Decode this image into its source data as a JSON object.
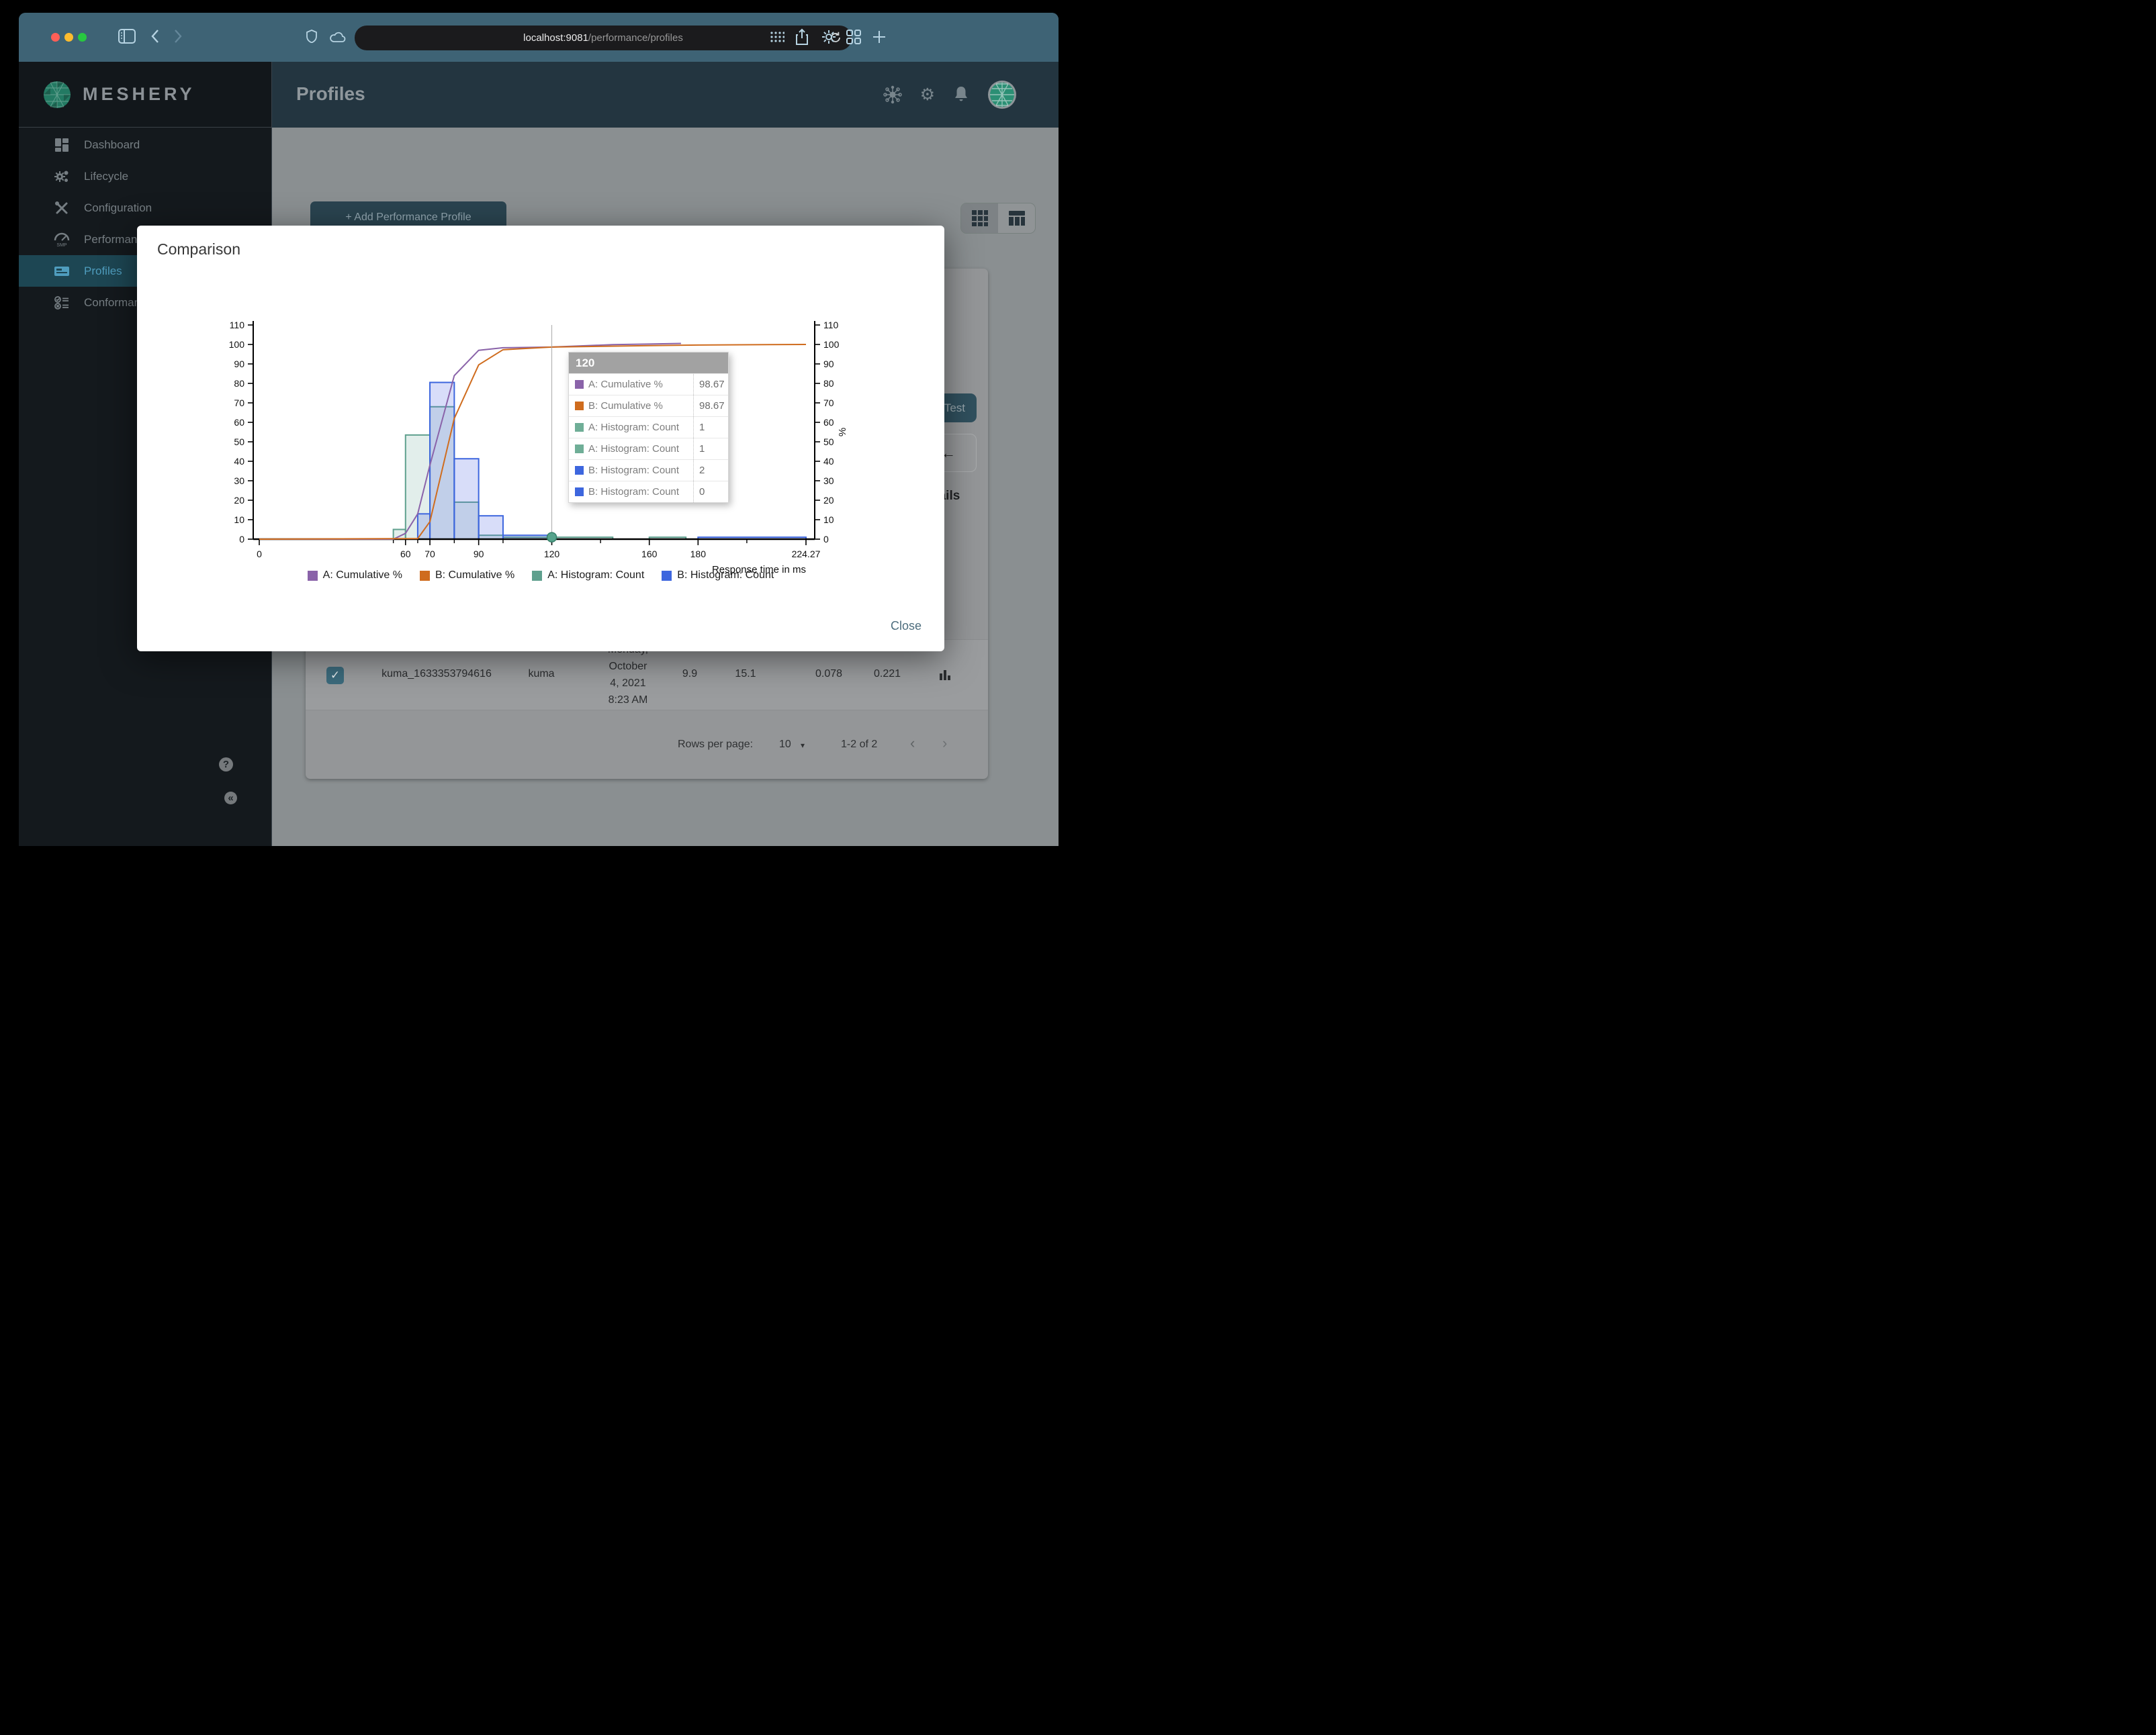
{
  "browser": {
    "url_host": "localhost:9081",
    "url_path": "/performance/profiles"
  },
  "sidebar": {
    "logo_text": "MESHERY",
    "items": [
      {
        "label": "Dashboard",
        "icon": "dashboard-icon",
        "selected": false
      },
      {
        "label": "Lifecycle",
        "icon": "lifecycle-icon",
        "selected": false
      },
      {
        "label": "Configuration",
        "icon": "configuration-icon",
        "selected": false
      },
      {
        "label": "Performance",
        "icon": "performance-icon",
        "selected": false
      },
      {
        "label": "Profiles",
        "icon": "profiles-icon",
        "selected": true
      },
      {
        "label": "Conformance",
        "icon": "conformance-icon",
        "selected": false
      }
    ],
    "help_label": "?",
    "collapse_label": "«"
  },
  "header": {
    "title": "Profiles"
  },
  "content": {
    "add_button_label": "+ Add Performance Profile",
    "test_button_label": "Test",
    "details_heading": "Details",
    "back_arrow": "←",
    "table_row": {
      "name": "kuma_1633353794616",
      "mesh": "kuma",
      "date_lines": [
        "Monday,",
        "October",
        "4, 2021",
        "8:23 AM"
      ],
      "qps": "9.9",
      "duration": "15.1",
      "p50": "0.078",
      "p99": "0.221"
    },
    "pagination": {
      "rows_per_page_label": "Rows per page:",
      "rows_per_page_value": "10",
      "range_label": "1-2 of 2"
    }
  },
  "modal": {
    "title": "Comparison",
    "close_label": "Close",
    "chart_data": {
      "type": "combo-histogram-cumulative",
      "x_axis": {
        "label": "Response time in ms",
        "range": [
          0,
          224.27
        ],
        "ticks_labeled": [
          0,
          60,
          70,
          90,
          120,
          160,
          180,
          224.27
        ],
        "tick_label_strings": [
          "0",
          "60",
          "70",
          "90",
          "120",
          "160",
          "180",
          "224.27"
        ],
        "ticks_minor": [
          55,
          65,
          80,
          100,
          140,
          200
        ]
      },
      "y_axis": {
        "range": [
          0,
          110
        ],
        "tick_step": 10,
        "right_label": "%"
      },
      "series": [
        {
          "name": "A: Cumulative %",
          "type": "line",
          "color": "#8a63a9",
          "points": [
            [
              0,
              0
            ],
            [
              55,
              0
            ],
            [
              60,
              3
            ],
            [
              65,
              13
            ],
            [
              70,
              38
            ],
            [
              80,
              84
            ],
            [
              90,
              97
            ],
            [
              100,
              98.3
            ],
            [
              120,
              98.67
            ],
            [
              145,
              99.9
            ],
            [
              160,
              100.2
            ],
            [
              173,
              100.5
            ]
          ]
        },
        {
          "name": "B: Cumulative %",
          "type": "line",
          "color": "#cf6c1e",
          "points": [
            [
              0,
              0
            ],
            [
              65,
              0.3
            ],
            [
              70,
              9
            ],
            [
              80,
              62
            ],
            [
              90,
              89.5
            ],
            [
              100,
              97.3
            ],
            [
              120,
              98.67
            ],
            [
              160,
              99.4
            ],
            [
              180,
              99.7
            ],
            [
              224.27,
              100
            ]
          ]
        },
        {
          "name": "A: Histogram: Count",
          "type": "histogram",
          "color": "#5fa08e",
          "fill": "rgba(95,160,142,0.18)",
          "bins": [
            [
              55,
              60,
              5
            ],
            [
              60,
              70,
              53.5
            ],
            [
              70,
              80,
              68
            ],
            [
              80,
              90,
              19
            ],
            [
              90,
              100,
              2
            ],
            [
              100,
              120,
              1
            ],
            [
              120,
              145,
              1
            ],
            [
              160,
              175,
              1
            ]
          ]
        },
        {
          "name": "B: Histogram: Count",
          "type": "histogram",
          "color": "#3d66de",
          "fill": "rgba(77,101,227,0.22)",
          "bins": [
            [
              65,
              70,
              13
            ],
            [
              70,
              80,
              80.5
            ],
            [
              80,
              90,
              41.3
            ],
            [
              90,
              100,
              12
            ],
            [
              100,
              120,
              2
            ],
            [
              180,
              224.27,
              1
            ]
          ]
        }
      ],
      "crosshair": {
        "x": 120,
        "marker_y": 1
      },
      "tooltip": {
        "title": "120",
        "rows": [
          {
            "color": "#8a63a9",
            "label": "A: Cumulative %",
            "value": "98.67"
          },
          {
            "color": "#cf6c1e",
            "label": "B: Cumulative %",
            "value": "98.67"
          },
          {
            "color": "#6fae97",
            "label": "A: Histogram: Count",
            "value": "1"
          },
          {
            "color": "#6fae97",
            "label": "A: Histogram: Count",
            "value": "1"
          },
          {
            "color": "#3d66de",
            "label": "B: Histogram: Count",
            "value": "2"
          },
          {
            "color": "#3d66de",
            "label": "B: Histogram: Count",
            "value": "0"
          }
        ]
      }
    }
  }
}
